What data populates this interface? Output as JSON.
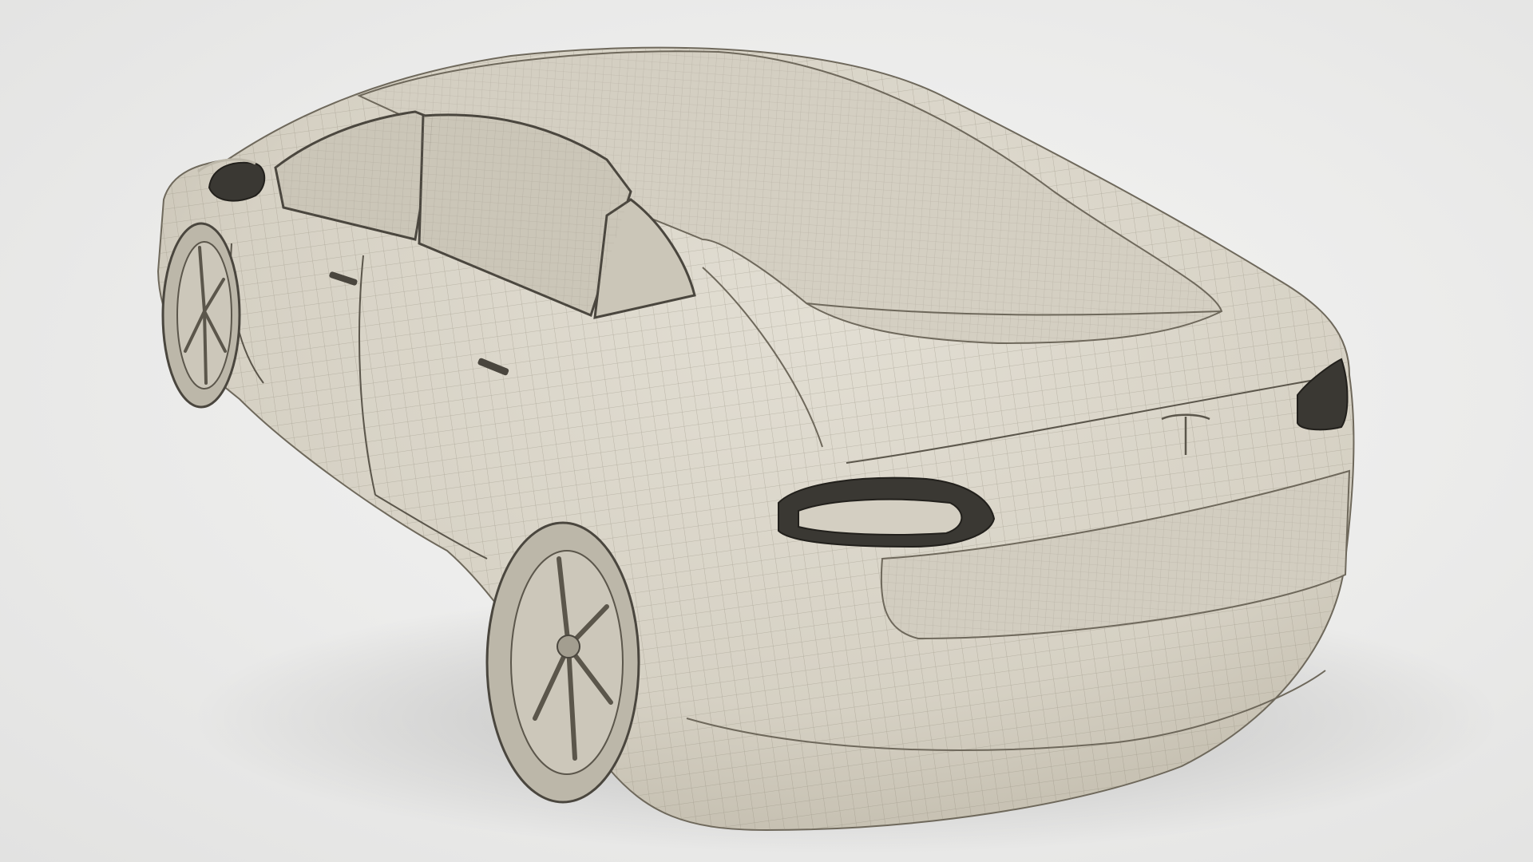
{
  "scene": {
    "subject_icon": "car-wireframe-icon",
    "colors": {
      "background": "#ebebea",
      "body_fill": "#d9d5c9",
      "body_shade": "#c4bfb1",
      "wire_line": "#8c8677",
      "dark_trim": "#3a3833",
      "glass": "#cfcabd"
    }
  }
}
